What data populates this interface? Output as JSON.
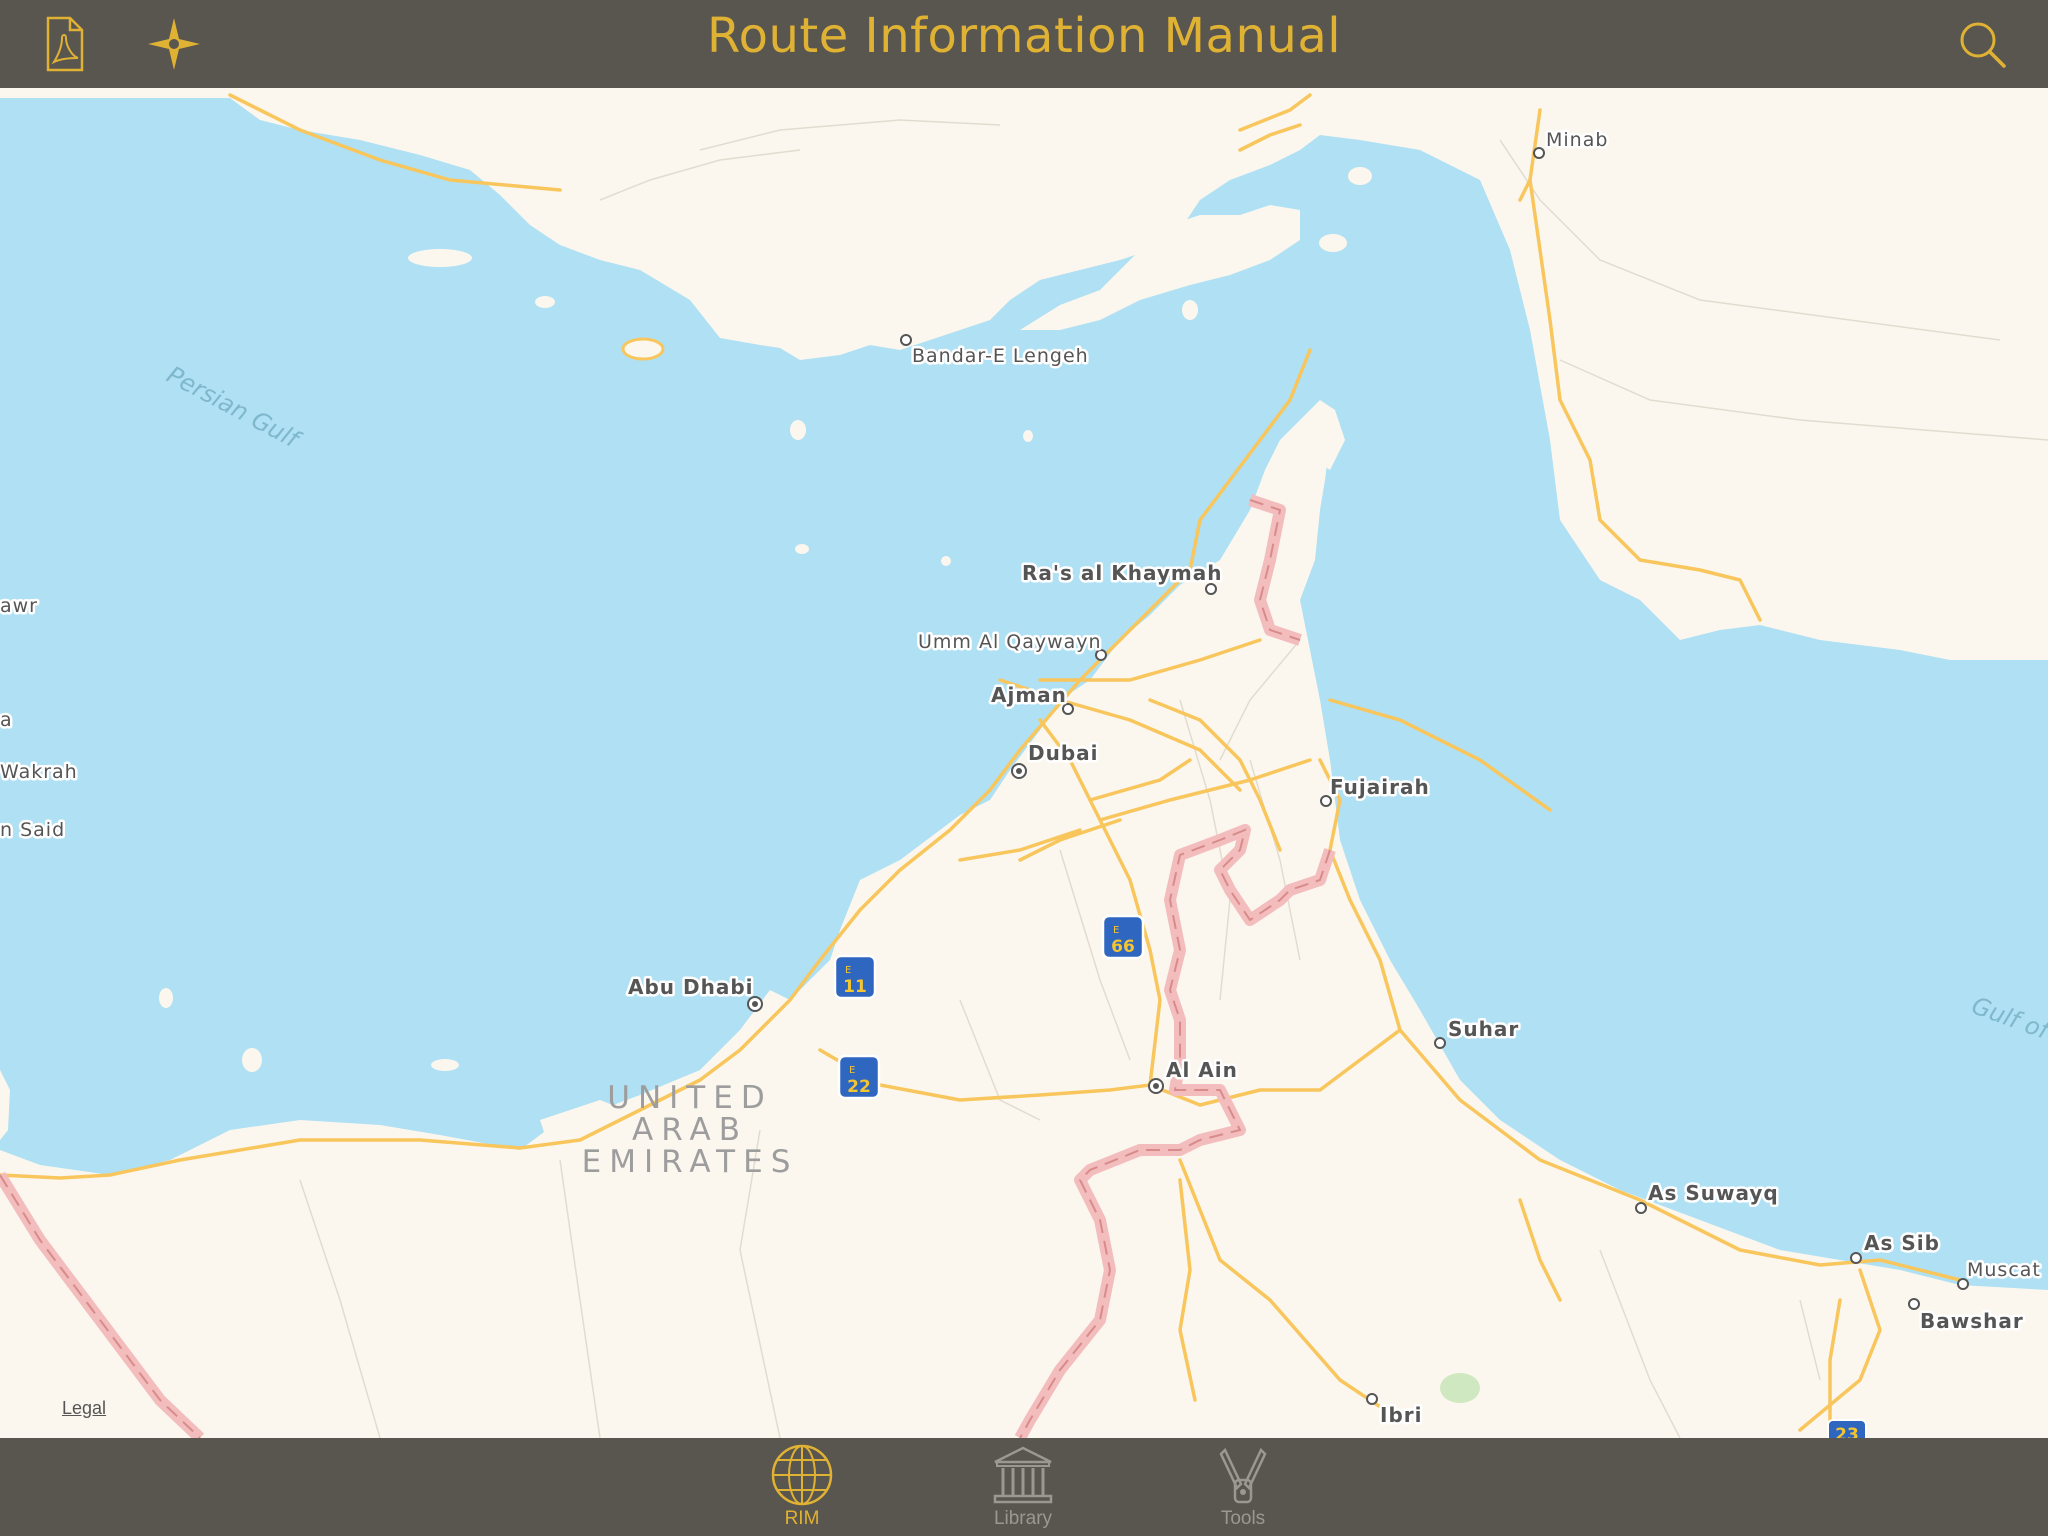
{
  "header": {
    "title": "Route Information Manual",
    "left_buttons": [
      {
        "icon": "pdf-document-icon"
      },
      {
        "icon": "compass-star-icon"
      }
    ],
    "right_button": {
      "icon": "search-icon"
    }
  },
  "map": {
    "legal_label": "Legal",
    "country_label": [
      "UNITED",
      "ARAB",
      "EMIRATES"
    ],
    "sea_labels": [
      "Persian Gulf",
      "Gulf of"
    ],
    "cities": [
      {
        "name": "Minab"
      },
      {
        "name": "Bandar-E Lengeh"
      },
      {
        "name": "Ra's al Khaymah"
      },
      {
        "name": "Umm Al Qaywayn"
      },
      {
        "name": "Ajman"
      },
      {
        "name": "Dubai"
      },
      {
        "name": "Fujairah"
      },
      {
        "name": "Abu Dhabi"
      },
      {
        "name": "Al Ain"
      },
      {
        "name": "Suhar"
      },
      {
        "name": "As Suwayq"
      },
      {
        "name": "As Sib"
      },
      {
        "name": "Muscat"
      },
      {
        "name": "Bawshar"
      },
      {
        "name": "Ibri"
      },
      {
        "name": "awr"
      },
      {
        "name": "a"
      },
      {
        "name": "Wakrah"
      },
      {
        "name": "n Said"
      }
    ],
    "highway_shields": [
      {
        "prefix": "E",
        "number": "11"
      },
      {
        "prefix": "E",
        "number": "66"
      },
      {
        "prefix": "E",
        "number": "22"
      },
      {
        "prefix": "",
        "number": "23"
      }
    ]
  },
  "tabs": [
    {
      "label": "RIM",
      "icon": "globe-icon",
      "active": true
    },
    {
      "label": "Library",
      "icon": "library-building-icon",
      "active": false
    },
    {
      "label": "Tools",
      "icon": "swiss-knife-tools-icon",
      "active": false
    }
  ],
  "colors": {
    "bar_background": "#59554f",
    "accent": "#e0b234",
    "water": "#afe0f3",
    "land": "#fbf7ee",
    "road": "#f8c65c",
    "border": "#f3bdbd"
  }
}
